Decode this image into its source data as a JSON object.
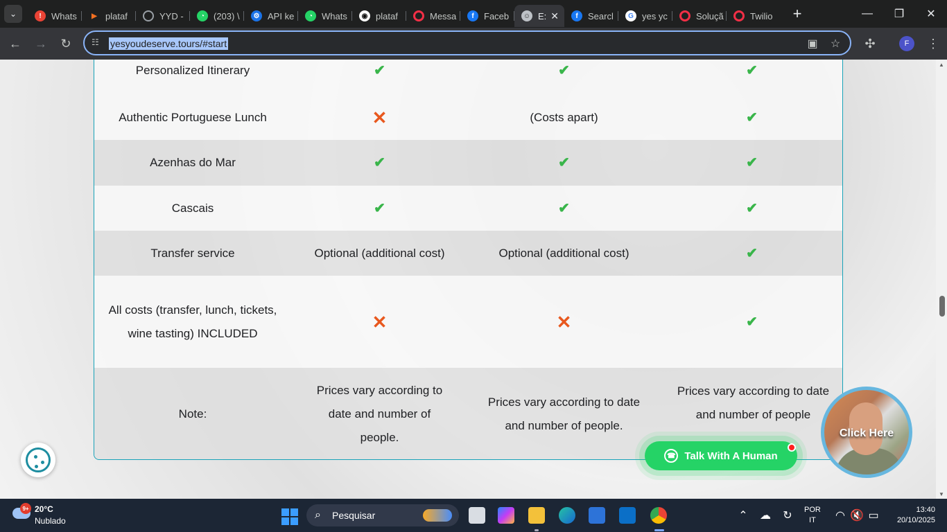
{
  "browser": {
    "tabs": [
      {
        "label": "Whats",
        "icon": "warning-icon",
        "color": "#ea4335",
        "active": false
      },
      {
        "label": "plataf",
        "icon": "platform-icon",
        "color": "#f37021",
        "active": false
      },
      {
        "label": "YYD -",
        "icon": "globe-icon",
        "color": "#9aa0a6",
        "active": false
      },
      {
        "label": "(203) \\",
        "icon": "whatsapp-icon",
        "color": "#25d366",
        "active": false
      },
      {
        "label": "API ke",
        "icon": "api-icon",
        "color": "#1a73e8",
        "active": false
      },
      {
        "label": "Whats",
        "icon": "whatsapp-icon",
        "color": "#25d366",
        "active": false
      },
      {
        "label": "plataf",
        "icon": "github-icon",
        "color": "#ffffff",
        "active": false
      },
      {
        "label": "Messa",
        "icon": "twilio-icon",
        "color": "#f22f46",
        "active": false
      },
      {
        "label": "Faceb",
        "icon": "facebook-icon",
        "color": "#1877f2",
        "active": false
      },
      {
        "label": "E:",
        "icon": "site-icon",
        "color": "#bdc1c6",
        "active": true
      },
      {
        "label": "Searcl",
        "icon": "facebook-icon",
        "color": "#1877f2",
        "active": false
      },
      {
        "label": "yes yc",
        "icon": "google-icon",
        "color": "#4285f4",
        "active": false
      },
      {
        "label": "Soluçã",
        "icon": "twilio-icon",
        "color": "#f22f46",
        "active": false
      },
      {
        "label": "Twilio",
        "icon": "twilio-icon",
        "color": "#f22f46",
        "active": false
      }
    ],
    "url": "yesyoudeserve.tours/#start",
    "profile_initial": "F"
  },
  "comparison": {
    "rows": [
      {
        "label": "Personalized Itinerary",
        "col1": "",
        "col2": "",
        "col3": "",
        "col1_icon": "check-icon",
        "col2_icon": "check-icon",
        "col3_icon": "check-icon"
      },
      {
        "label": "Authentic Portuguese Lunch",
        "col1": "",
        "col2": "(Costs apart)",
        "col3": "",
        "col1_icon": "cross-icon",
        "col2_icon": "",
        "col3_icon": "check-icon"
      },
      {
        "label": "Azenhas do Mar",
        "col1": "",
        "col2": "",
        "col3": "",
        "col1_icon": "check-icon",
        "col2_icon": "check-icon",
        "col3_icon": "check-icon"
      },
      {
        "label": "Cascais",
        "col1": "",
        "col2": "",
        "col3": "",
        "col1_icon": "check-icon",
        "col2_icon": "check-icon",
        "col3_icon": "check-icon"
      },
      {
        "label": "Transfer service",
        "col1": "Optional (additional cost)",
        "col2": "Optional (additional cost)",
        "col3": "",
        "col1_icon": "",
        "col2_icon": "",
        "col3_icon": "check-icon"
      },
      {
        "label": "All costs (transfer, lunch, tickets, wine tasting) INCLUDED",
        "col1": "",
        "col2": "",
        "col3": "",
        "col1_icon": "cross-icon",
        "col2_icon": "cross-icon",
        "col3_icon": "check-icon"
      },
      {
        "label": "Note:",
        "col1": "Prices vary according to date and number of people.",
        "col2": "Prices vary according to date and number of people.",
        "col3": "Prices vary according to date and number of people",
        "col1_icon": "",
        "col2_icon": "",
        "col3_icon": ""
      }
    ]
  },
  "widgets": {
    "talk_label": "Talk With A Human",
    "click_label": "Click Here"
  },
  "taskbar": {
    "weather_badge": "9+",
    "temperature": "20°C",
    "weather": "Nublado",
    "search_placeholder": "Pesquisar",
    "language_top": "POR",
    "language_bottom": "IT",
    "time": "13:40",
    "date": "20/10/2025"
  },
  "colors": {
    "accent": "#17a2b8",
    "check": "#39b54a",
    "cross": "#e8581e",
    "whatsapp": "#25d366"
  }
}
